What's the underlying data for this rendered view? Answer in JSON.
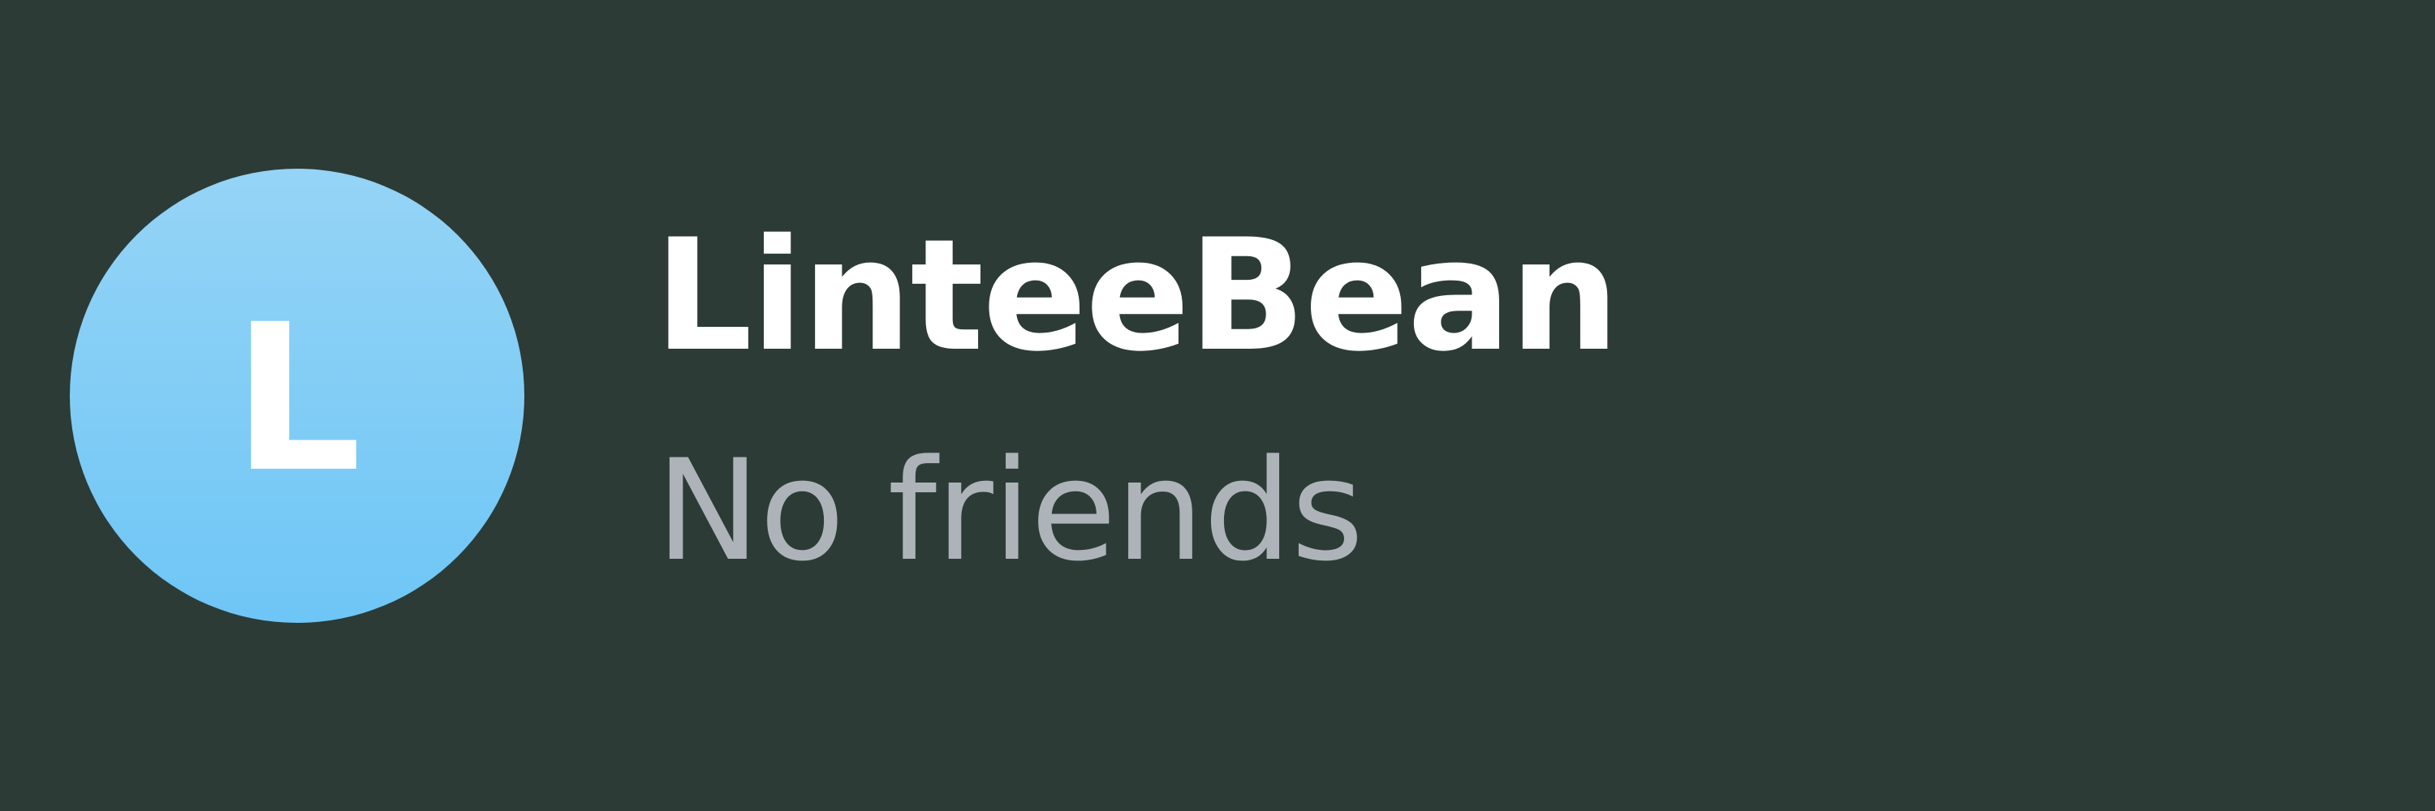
{
  "profile": {
    "avatar_initial": "L",
    "username": "LinteeBean",
    "status": "No friends"
  },
  "colors": {
    "background": "#2c3b36",
    "avatar_gradient_top": "#95d4f6",
    "avatar_gradient_bottom": "#6ec6f6",
    "username_text": "#ffffff",
    "status_text": "#aeb3ba"
  },
  "icons": {
    "avatar": "letter-avatar-icon"
  }
}
